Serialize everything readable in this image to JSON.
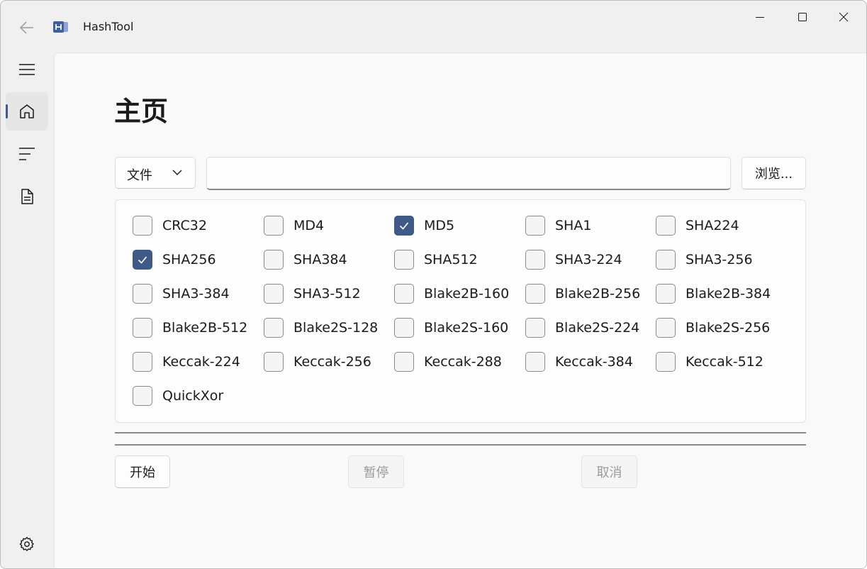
{
  "app": {
    "title": "HashTool"
  },
  "page": {
    "title": "主页"
  },
  "input": {
    "mode": "文件",
    "path_value": "",
    "browse_label": "浏览..."
  },
  "algorithms": [
    {
      "label": "CRC32",
      "checked": false
    },
    {
      "label": "MD4",
      "checked": false
    },
    {
      "label": "MD5",
      "checked": true
    },
    {
      "label": "SHA1",
      "checked": false
    },
    {
      "label": "SHA224",
      "checked": false
    },
    {
      "label": "SHA256",
      "checked": true
    },
    {
      "label": "SHA384",
      "checked": false
    },
    {
      "label": "SHA512",
      "checked": false
    },
    {
      "label": "SHA3-224",
      "checked": false
    },
    {
      "label": "SHA3-256",
      "checked": false
    },
    {
      "label": "SHA3-384",
      "checked": false
    },
    {
      "label": "SHA3-512",
      "checked": false
    },
    {
      "label": "Blake2B-160",
      "checked": false
    },
    {
      "label": "Blake2B-256",
      "checked": false
    },
    {
      "label": "Blake2B-384",
      "checked": false
    },
    {
      "label": "Blake2B-512",
      "checked": false
    },
    {
      "label": "Blake2S-128",
      "checked": false
    },
    {
      "label": "Blake2S-160",
      "checked": false
    },
    {
      "label": "Blake2S-224",
      "checked": false
    },
    {
      "label": "Blake2S-256",
      "checked": false
    },
    {
      "label": "Keccak-224",
      "checked": false
    },
    {
      "label": "Keccak-256",
      "checked": false
    },
    {
      "label": "Keccak-288",
      "checked": false
    },
    {
      "label": "Keccak-384",
      "checked": false
    },
    {
      "label": "Keccak-512",
      "checked": false
    },
    {
      "label": "QuickXor",
      "checked": false
    }
  ],
  "actions": {
    "start_label": "开始",
    "pause_label": "暂停",
    "cancel_label": "取消"
  },
  "colors": {
    "accent": "#3f5a86"
  },
  "nav": {
    "items": [
      "menu-icon",
      "home-icon",
      "list-icon",
      "document-icon",
      "settings-icon"
    ],
    "selected": "home-icon"
  }
}
